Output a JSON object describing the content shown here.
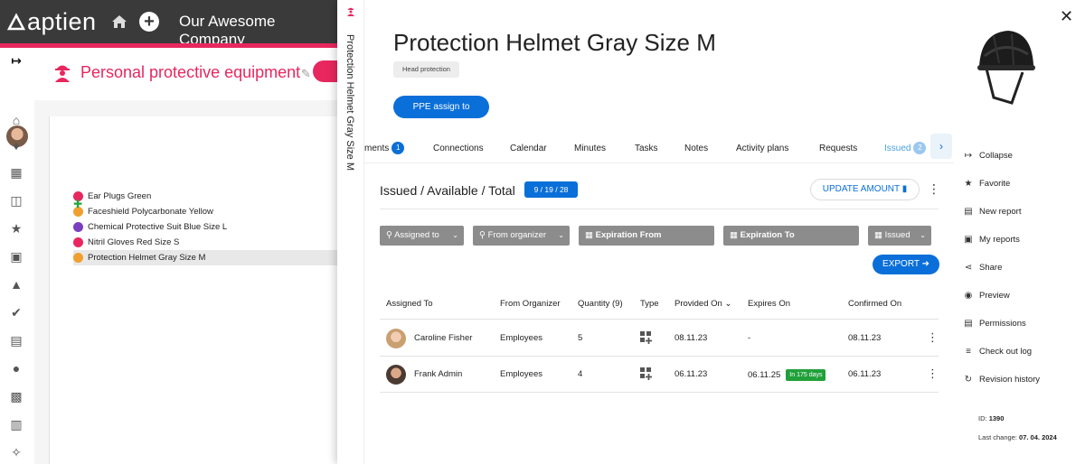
{
  "app": {
    "logo_text": "aptien",
    "company": "Our Awesome Company"
  },
  "background": {
    "page_title": "Personal protective equipment",
    "tree_items": [
      {
        "label": "Ear Plugs Green",
        "color": "#e8275f"
      },
      {
        "label": "Faceshield Polycarbonate Yellow",
        "color": "#f0a030"
      },
      {
        "label": "Chemical Protective Suit Blue Size L",
        "color": "#7a3fc0"
      },
      {
        "label": "Nitril Gloves Red Size S",
        "color": "#e8275f"
      },
      {
        "label": "Protection Helmet Gray Size M",
        "color": "#f0a030"
      }
    ],
    "nav_icons": [
      "expand-icon",
      "avatar",
      "home-icon",
      "bell-icon",
      "calendar-icon",
      "clipboard-icon",
      "star-icon",
      "document-icon",
      "dog-icon",
      "check-circle-icon",
      "report-icon",
      "person-icon",
      "clipboard-list-icon",
      "library-icon",
      "network-icon"
    ]
  },
  "panel": {
    "vertical_title": "Protection Helmet Gray Size M",
    "title": "Protection Helmet Gray Size M",
    "tag": "Head protection",
    "assign_button": "PPE assign to",
    "tabs": [
      {
        "label": "ments",
        "badge": "1"
      },
      {
        "label": "Connections"
      },
      {
        "label": "Calendar"
      },
      {
        "label": "Minutes"
      },
      {
        "label": "Tasks"
      },
      {
        "label": "Notes"
      },
      {
        "label": "Activity plans"
      },
      {
        "label": "Requests"
      },
      {
        "label": "Issued",
        "badge": "2",
        "active": true
      }
    ],
    "summary_label": "Issued / Available / Total",
    "summary_value": "9 / 19 / 28",
    "update_button": "UPDATE AMOUNT",
    "filters": [
      {
        "label": "Assigned to",
        "kind": "search"
      },
      {
        "label": "From organizer",
        "kind": "search"
      },
      {
        "label": "Expiration From",
        "kind": "date"
      },
      {
        "label": "Expiration To",
        "kind": "date"
      },
      {
        "label": "Issued",
        "kind": "select"
      }
    ],
    "export_button": "EXPORT",
    "table": {
      "headers": [
        "Assigned To",
        "From Organizer",
        "Quantity (9)",
        "Type",
        "Provided On",
        "Expires On",
        "Confirmed On"
      ],
      "rows": [
        {
          "assigned_to": "Caroline Fisher",
          "from": "Employees",
          "qty": "5",
          "provided": "08.11.23",
          "expires": "-",
          "expires_badge": "",
          "confirmed": "08.11.23"
        },
        {
          "assigned_to": "Frank Admin",
          "from": "Employees",
          "qty": "4",
          "provided": "06.11.23",
          "expires": "06.11.25",
          "expires_badge": "In 175 days",
          "confirmed": "06.11.23"
        }
      ]
    },
    "actions": [
      {
        "label": "Collapse",
        "icon": "collapse-icon"
      },
      {
        "label": "Favorite",
        "icon": "star-icon"
      },
      {
        "label": "New report",
        "icon": "new-report-icon"
      },
      {
        "label": "My reports",
        "icon": "my-reports-icon"
      },
      {
        "label": "Share",
        "icon": "share-icon"
      },
      {
        "label": "Preview",
        "icon": "eye-icon"
      },
      {
        "label": "Permissions",
        "icon": "permissions-icon"
      },
      {
        "label": "Check out log",
        "icon": "checkout-log-icon"
      },
      {
        "label": "Revision history",
        "icon": "history-icon"
      }
    ],
    "meta": {
      "id_label": "ID:",
      "id_value": "1390",
      "last_change_label": "Last change:",
      "last_change_value": "07. 04. 2024"
    }
  },
  "colors": {
    "accent_pink": "#e8275f",
    "primary_blue": "#0a6fd8",
    "success_green": "#21a03a",
    "topbar": "#3a3a3a"
  }
}
